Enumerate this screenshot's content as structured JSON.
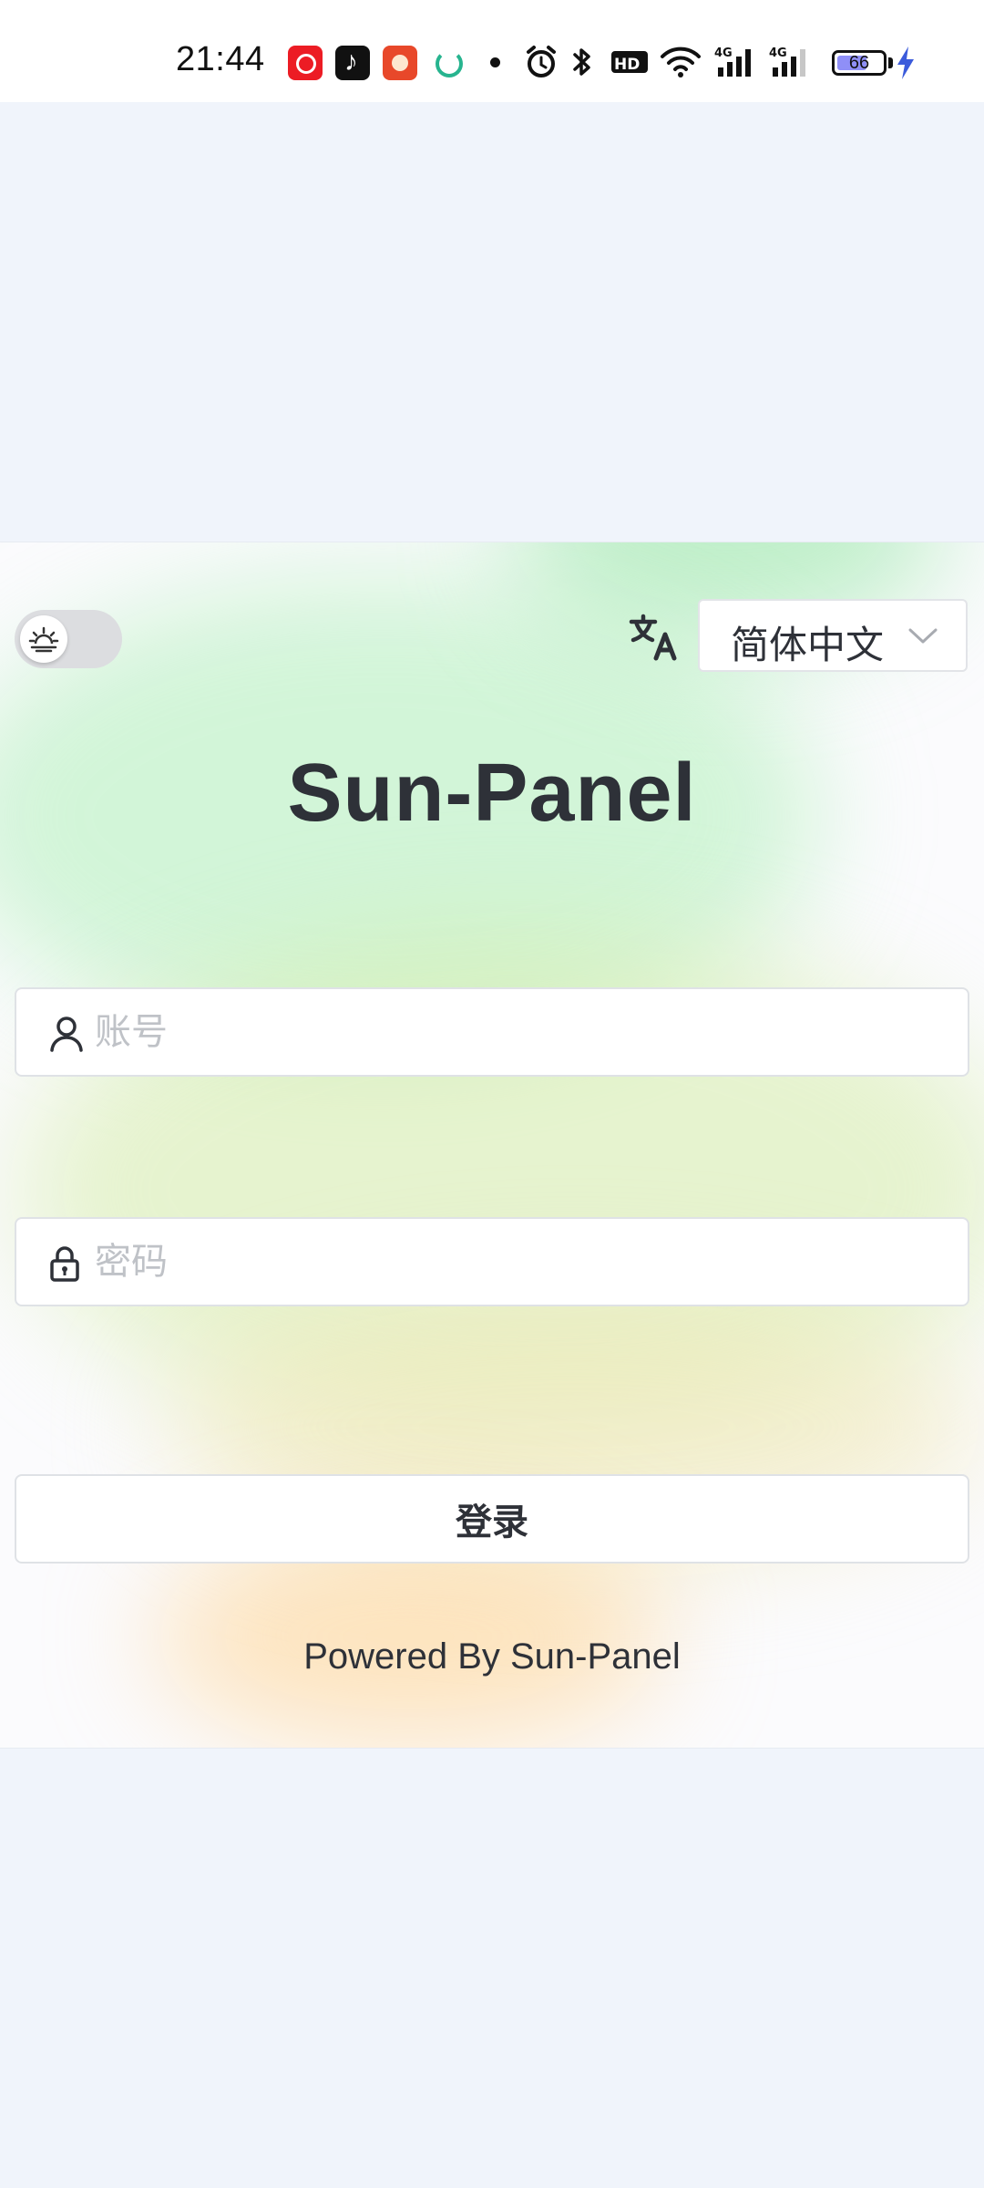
{
  "status_bar": {
    "time": "21:44",
    "notification_icons": [
      "netease-music-icon",
      "tiktok-icon",
      "game-app-icon",
      "sync-spinner-icon",
      "dot-icon"
    ],
    "system_icons": [
      "alarm-icon",
      "bluetooth-icon",
      "hd-icon",
      "wifi-icon",
      "signal-4g-icon",
      "signal-4g-icon"
    ],
    "battery_level": 66,
    "battery_text": "66",
    "charging": true
  },
  "login": {
    "theme_toggle": {
      "state": "light",
      "icon": "sunrise-icon"
    },
    "language": {
      "icon": "translate-icon",
      "selected": "简体中文"
    },
    "title": "Sun-Panel",
    "username": {
      "placeholder": "账号",
      "value": "",
      "icon": "user-icon"
    },
    "password": {
      "placeholder": "密码",
      "value": "",
      "icon": "lock-icon"
    },
    "submit_label": "登录",
    "footer": "Powered By  Sun-Panel"
  },
  "colors": {
    "page_background": "#f0f4fb",
    "card_background": "#fbfbfd",
    "text": "#2e3138",
    "placeholder": "#bfc2c7",
    "border": "#dfe2e6",
    "battery_fill": "#8f8ff7",
    "charge_bolt": "#3b5bdb"
  }
}
